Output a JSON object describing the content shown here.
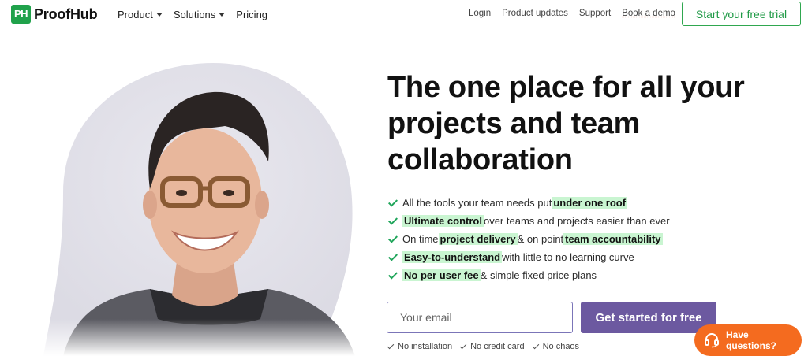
{
  "brand": {
    "logo_mark": "PH",
    "name": "ProofHub",
    "color": "#20a24b"
  },
  "nav": {
    "left": [
      {
        "label": "Product",
        "has_dropdown": true
      },
      {
        "label": "Solutions",
        "has_dropdown": true
      },
      {
        "label": "Pricing",
        "has_dropdown": false
      }
    ],
    "right": [
      "Login",
      "Product updates",
      "Support",
      "Book a demo"
    ],
    "trial_button": "Start your free trial"
  },
  "hero": {
    "headline": "The one place for all your projects and team collaboration",
    "features": [
      {
        "before": "All the tools your team needs put ",
        "h1": "under one roof",
        "mid": "",
        "h2": "",
        "after": ""
      },
      {
        "before": "",
        "h1": "Ultimate control",
        "mid": "",
        "h2": "",
        "after": " over teams and projects easier than ever"
      },
      {
        "before": "On time ",
        "h1": "project delivery",
        "mid": " & on point ",
        "h2": "team accountability",
        "after": ""
      },
      {
        "before": "",
        "h1": "Easy-to-understand",
        "mid": "",
        "h2": "",
        "after": " with little to no learning curve"
      },
      {
        "before": "",
        "h1": "No per user fee",
        "mid": "",
        "h2": "",
        "after": " & simple fixed price plans"
      }
    ],
    "email_placeholder": "Your email",
    "cta": "Get started for free",
    "perks": [
      "No installation",
      "No credit card",
      "No chaos"
    ]
  },
  "help_widget": {
    "label": "Have questions?",
    "icon": "headset-icon",
    "color": "#f46b1f"
  },
  "colors": {
    "accent": "#6c59a0",
    "highlight": "#c9f5d1",
    "check": "#1fa55a"
  }
}
